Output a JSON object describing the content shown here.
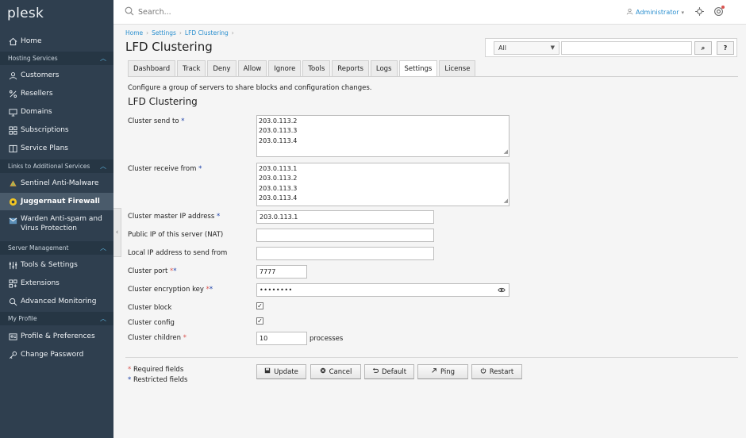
{
  "app": {
    "logo": "plesk"
  },
  "sidebar": {
    "home": "Home",
    "hosting_section": "Hosting Services",
    "hosting_items": [
      "Customers",
      "Resellers",
      "Domains",
      "Subscriptions",
      "Service Plans"
    ],
    "links_section": "Links to Additional Services",
    "links_items": [
      "Sentinel Anti-Malware",
      "Juggernaut Firewall",
      "Warden Anti-spam and",
      "Virus Protection"
    ],
    "server_section": "Server Management",
    "server_items": [
      "Tools & Settings",
      "Extensions",
      "Advanced Monitoring"
    ],
    "profile_section": "My Profile",
    "profile_items": [
      "Profile & Preferences",
      "Change Password"
    ]
  },
  "topbar": {
    "search_placeholder": "Search...",
    "user": "Administrator"
  },
  "breadcrumb": [
    "Home",
    "Settings",
    "LFD Clustering"
  ],
  "page": {
    "title": "LFD Clustering"
  },
  "filter": {
    "selected": "All",
    "search_btn": "⌕",
    "help_btn": "?"
  },
  "tabs": [
    "Dashboard",
    "Track",
    "Deny",
    "Allow",
    "Ignore",
    "Tools",
    "Reports",
    "Logs",
    "Settings",
    "License"
  ],
  "active_tab": "Settings",
  "form": {
    "description": "Configure a group of servers to share blocks and configuration changes.",
    "section_title": "LFD Clustering",
    "cluster_send_to": {
      "label": "Cluster send to",
      "lines": [
        "203.0.113.2",
        "203.0.113.3",
        "203.0.113.4"
      ]
    },
    "cluster_receive_from": {
      "label": "Cluster receive from",
      "lines": [
        "203.0.113.1",
        "203.0.113.2",
        "203.0.113.3",
        "203.0.113.4"
      ]
    },
    "cluster_master_ip": {
      "label": "Cluster master IP address",
      "value": "203.0.113.1"
    },
    "public_ip": {
      "label": "Public IP of this server (NAT)",
      "value": ""
    },
    "local_ip": {
      "label": "Local IP address to send from",
      "value": ""
    },
    "cluster_port": {
      "label": "Cluster port",
      "value": "7777"
    },
    "encryption_key": {
      "label": "Cluster encryption key",
      "value": "••••••••"
    },
    "cluster_block": {
      "label": "Cluster block",
      "checked": true
    },
    "cluster_config": {
      "label": "Cluster config",
      "checked": true
    },
    "cluster_children": {
      "label": "Cluster children",
      "value": "10",
      "suffix": "processes"
    }
  },
  "legend": {
    "required": "Required fields",
    "restricted": "Restricted fields"
  },
  "buttons": {
    "update": "Update",
    "cancel": "Cancel",
    "default": "Default",
    "ping": "Ping",
    "restart": "Restart"
  }
}
